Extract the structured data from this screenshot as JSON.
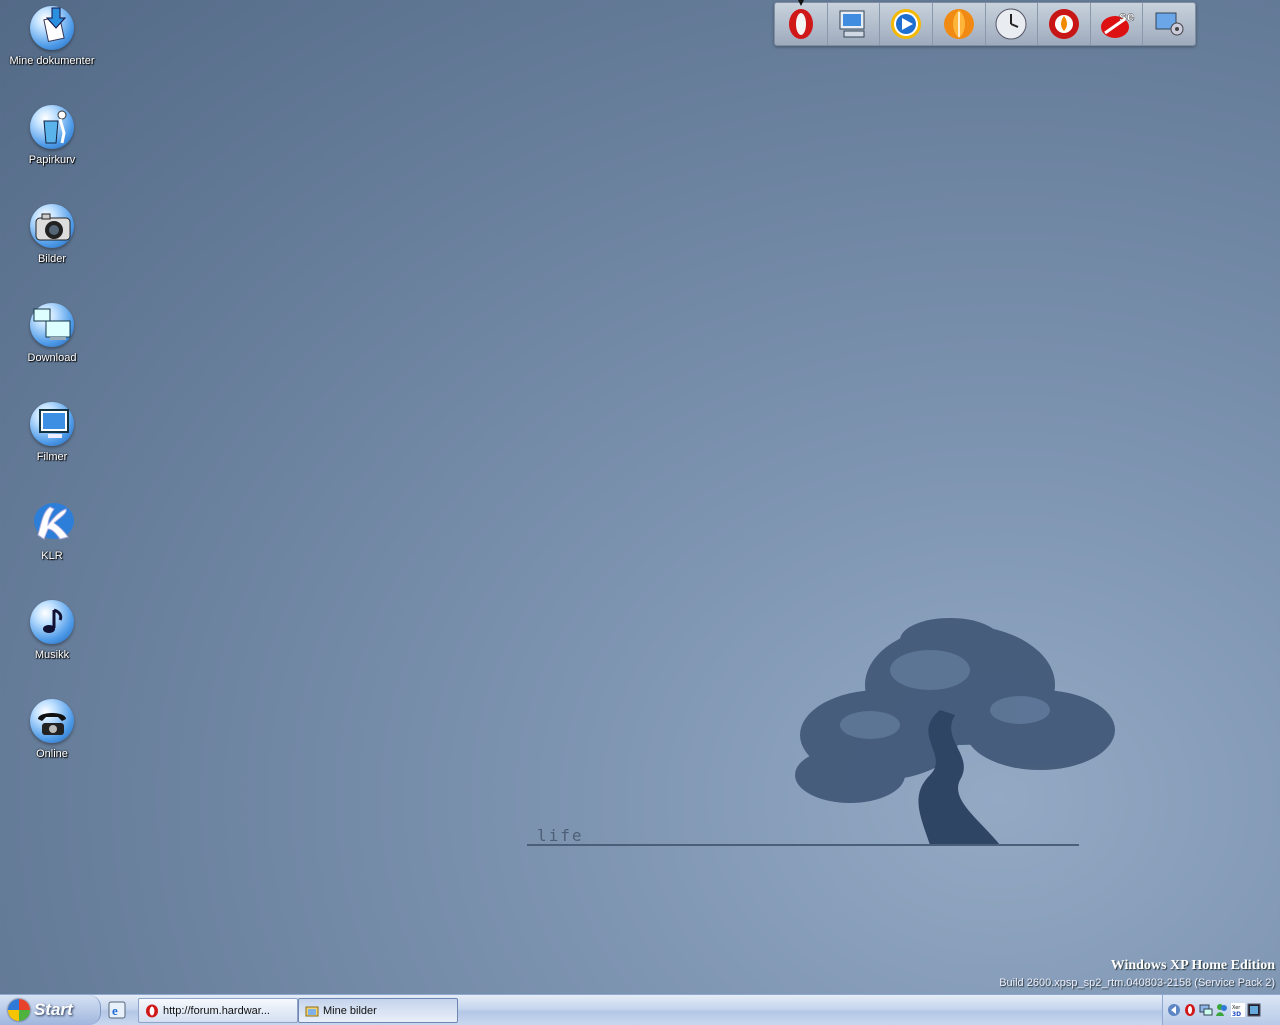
{
  "desktop": {
    "icons": [
      {
        "label": "Mine dokumenter",
        "icon": "documents-icon"
      },
      {
        "label": "Papirkurv",
        "icon": "recycle-bin-icon"
      },
      {
        "label": "Bilder",
        "icon": "camera-icon"
      },
      {
        "label": "Download",
        "icon": "download-icon"
      },
      {
        "label": "Filmer",
        "icon": "monitor-icon"
      },
      {
        "label": "KLR",
        "icon": "klr-icon"
      },
      {
        "label": "Musikk",
        "icon": "music-note-icon"
      },
      {
        "label": "Online",
        "icon": "telephone-icon"
      }
    ]
  },
  "dock": {
    "items": [
      "opera-icon",
      "my-computer-icon",
      "media-player-icon",
      "vlc-cone-icon",
      "clock-icon",
      "burner-icon",
      "sandisk-icon",
      "settings-icon"
    ]
  },
  "wallpaper": {
    "caption": "life"
  },
  "watermark": {
    "edition": "Windows XP Home Edition",
    "build": "Build 2600.xpsp_sp2_rtm.040803-2158 (Service Pack 2)"
  },
  "taskbar": {
    "start_label": "Start",
    "tasks": [
      {
        "label": "http://forum.hardwar...",
        "icon": "opera-icon",
        "active": false
      },
      {
        "label": "Mine bilder",
        "icon": "folder-icon",
        "active": true
      }
    ]
  },
  "colors": {
    "desktop_base": "#7e95b2",
    "taskbar": "#c6d6ee"
  }
}
